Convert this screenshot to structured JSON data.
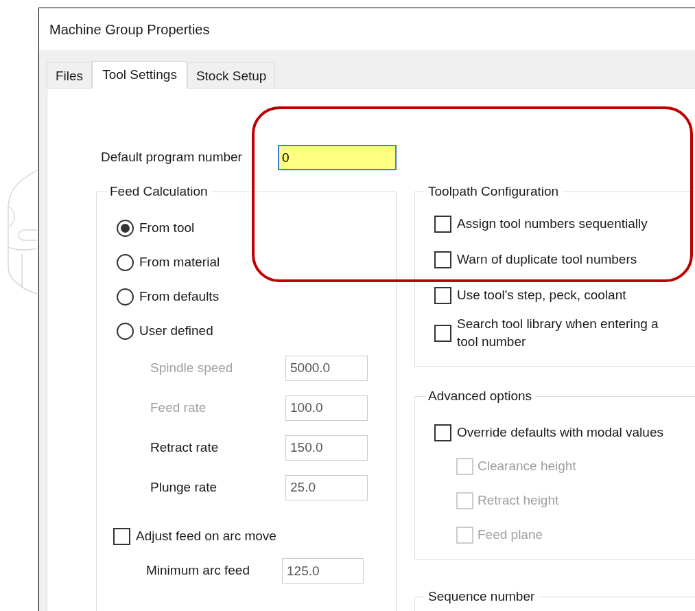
{
  "window": {
    "title": "Machine Group Properties"
  },
  "tabs": [
    {
      "label": "Files",
      "selected": false
    },
    {
      "label": "Tool Settings",
      "selected": true
    },
    {
      "label": "Stock Setup",
      "selected": false
    }
  ],
  "program_number": {
    "label": "Default program number",
    "value": "0"
  },
  "feed_calculation": {
    "title": "Feed Calculation",
    "options": [
      {
        "label": "From tool",
        "selected": true
      },
      {
        "label": "From material",
        "selected": false
      },
      {
        "label": "From defaults",
        "selected": false
      },
      {
        "label": "User defined",
        "selected": false
      }
    ],
    "fields": [
      {
        "label": "Spindle speed",
        "value": "5000.0",
        "disabled": true
      },
      {
        "label": "Feed rate",
        "value": "100.0",
        "disabled": true
      },
      {
        "label": "Retract rate",
        "value": "150.0",
        "disabled": false
      },
      {
        "label": "Plunge rate",
        "value": "25.0",
        "disabled": false
      }
    ],
    "arc_adjust": {
      "label": "Adjust feed on arc move",
      "checked": false
    },
    "min_arc_feed": {
      "label": "Minimum arc feed",
      "value": "125.0"
    }
  },
  "toolpath_configuration": {
    "title": "Toolpath Configuration",
    "options": [
      {
        "label": "Assign tool numbers sequentially",
        "checked": false
      },
      {
        "label": "Warn of duplicate tool numbers",
        "checked": false
      },
      {
        "label": "Use tool's step, peck, coolant",
        "checked": false
      },
      {
        "label": "Search tool library when entering a tool number",
        "checked": false
      }
    ]
  },
  "advanced_options": {
    "title": "Advanced options",
    "override": {
      "label": "Override defaults with modal values",
      "checked": false
    },
    "options": [
      {
        "label": "Clearance height",
        "checked": false,
        "disabled": true
      },
      {
        "label": "Retract height",
        "checked": false,
        "disabled": true
      },
      {
        "label": "Feed plane",
        "checked": false,
        "disabled": true
      }
    ]
  },
  "sequence_number": {
    "title": "Sequence number"
  }
}
